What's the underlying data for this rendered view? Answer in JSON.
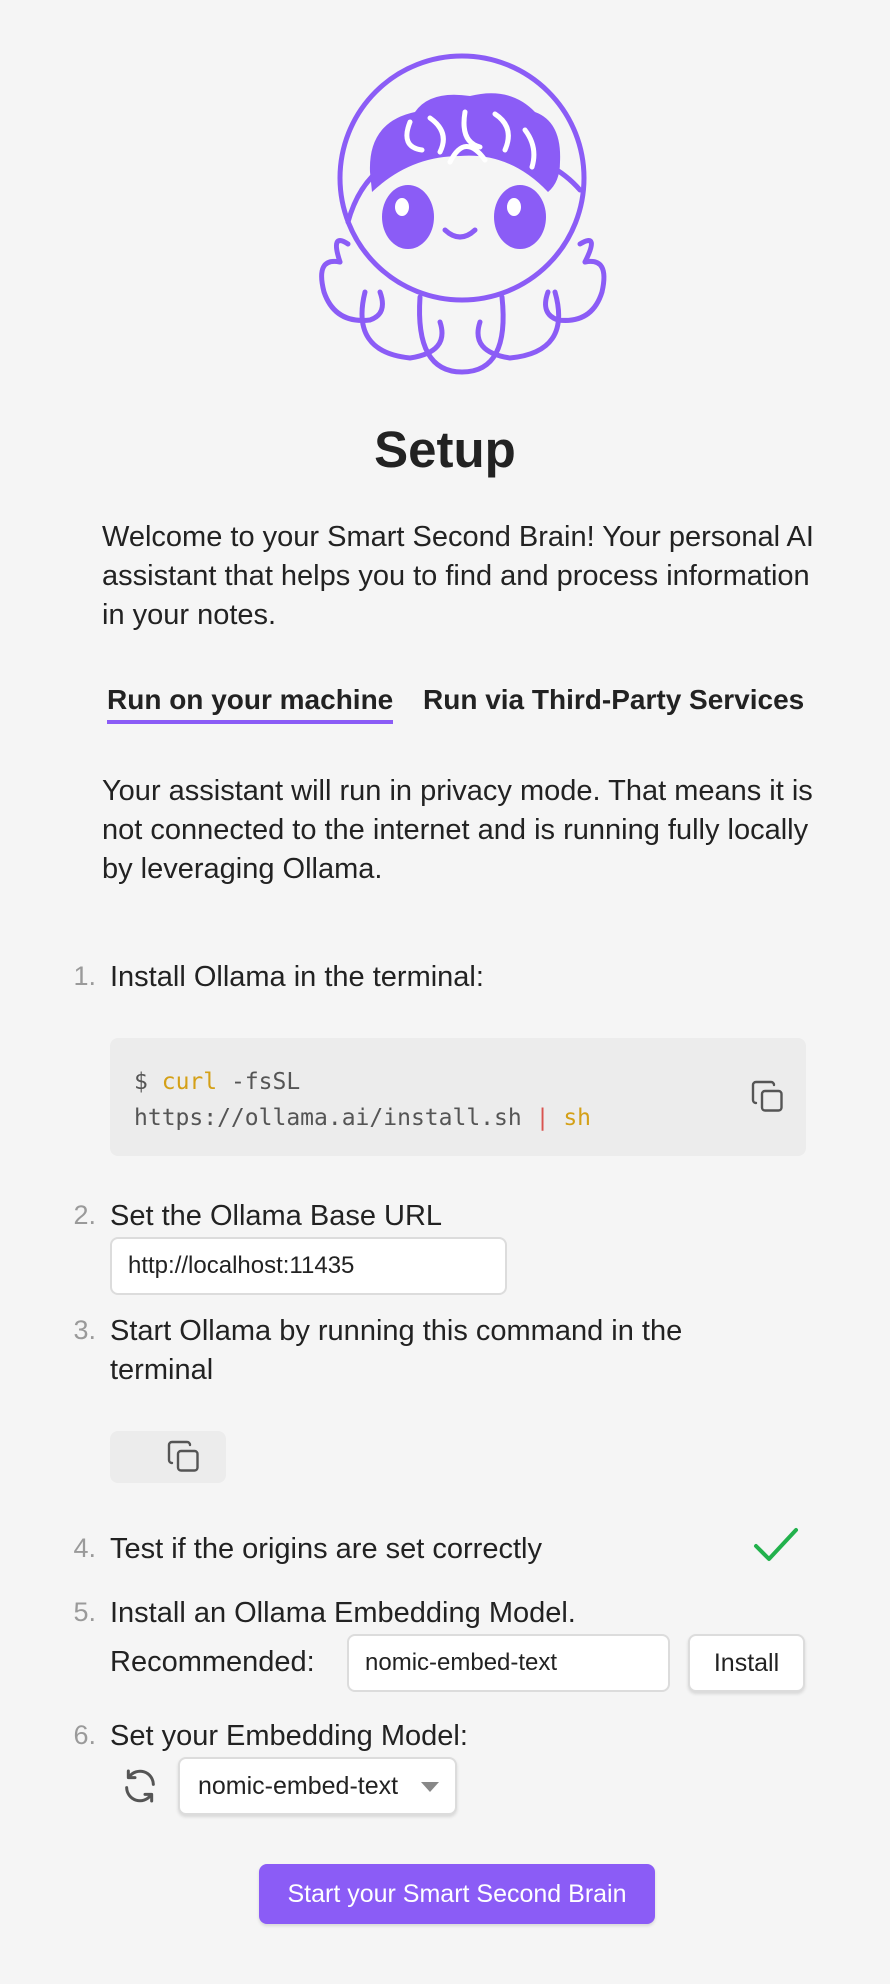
{
  "title": "Setup",
  "intro": "Welcome to your Smart Second Brain! Your personal AI assistant that helps you to find and process information in your notes.",
  "tabs": [
    {
      "label": "Run on your machine",
      "active": true
    },
    {
      "label": "Run via Third-Party Services",
      "active": false
    }
  ],
  "privacy_text": "Your assistant will run in privacy mode. That means it is not connected to the internet and is running fully locally by leveraging Ollama.",
  "steps": [
    {
      "number": "1.",
      "text": "Install Ollama in the terminal:"
    },
    {
      "number": "2.",
      "text": "Set the Ollama Base URL"
    },
    {
      "number": "3.",
      "text": "Start Ollama by running this command in the terminal"
    },
    {
      "number": "4.",
      "text": "Test if the origins are set correctly"
    },
    {
      "number": "5.",
      "text": "Install an Ollama Embedding Model."
    },
    {
      "number": "6.",
      "text": "Set your Embedding Model:"
    }
  ],
  "install_code": {
    "prompt": "$",
    "cmd": "curl",
    "flags": "-fsSL",
    "url": "https://ollama.ai/install.sh",
    "pipe": "|",
    "shell": "sh"
  },
  "base_url": "http://localhost:11435",
  "origins_test_passed": true,
  "recommended_label": "Recommended:",
  "recommended_model": "nomic-embed-text",
  "install_button": "Install",
  "embedding_model_selected": "nomic-embed-text",
  "start_button": "Start your Smart Second Brain",
  "colors": {
    "accent": "#8b5cf6",
    "success": "#22b14c",
    "code_cmd": "#d4a017",
    "code_pipe": "#d9534f",
    "background": "#f5f5f5"
  },
  "icons": {
    "logo": "octopus-brain-logo",
    "copy": "copy-icon",
    "check": "check-icon",
    "refresh": "refresh-icon",
    "dropdown": "chevron-down-icon"
  }
}
